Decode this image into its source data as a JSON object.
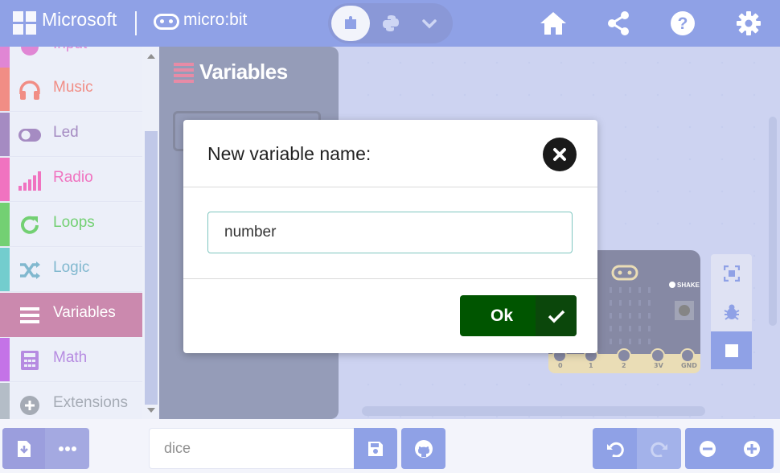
{
  "header": {
    "brand": "Microsoft",
    "product": "micro:bit",
    "icons": [
      "home-icon",
      "share-icon",
      "help-icon",
      "settings-icon"
    ]
  },
  "toolbox": {
    "categories": [
      {
        "label": "Input",
        "color": "#c724b1",
        "icon": "input-icon"
      },
      {
        "label": "Music",
        "color": "#e63022",
        "icon": "headphones-icon"
      },
      {
        "label": "Led",
        "color": "#5c2d91",
        "icon": "toggle-icon"
      },
      {
        "label": "Radio",
        "color": "#e3008c",
        "icon": "signal-icon"
      },
      {
        "label": "Loops",
        "color": "#00aa00",
        "icon": "loop-icon"
      },
      {
        "label": "Logic",
        "color": "#00a4a6",
        "icon": "shuffle-icon"
      },
      {
        "label": "Variables",
        "color": "#dc143c",
        "icon": "list-icon",
        "selected": true
      },
      {
        "label": "Math",
        "color": "#9400d3",
        "icon": "calculator-icon"
      },
      {
        "label": "Extensions",
        "color": "#778899",
        "icon": "plus-circle-icon"
      }
    ]
  },
  "flyout": {
    "title": "Variables"
  },
  "dialog": {
    "title": "New variable name:",
    "input_value": "number",
    "ok_label": "Ok"
  },
  "simulator": {
    "shake_label": "SHAKE",
    "pins": [
      "0",
      "1",
      "2",
      "3V",
      "GND"
    ]
  },
  "bottom": {
    "project_name": "dice"
  },
  "colors": {
    "header": "#3454d1",
    "ok_button": "#005500",
    "variables_selected": "#a0296c"
  }
}
